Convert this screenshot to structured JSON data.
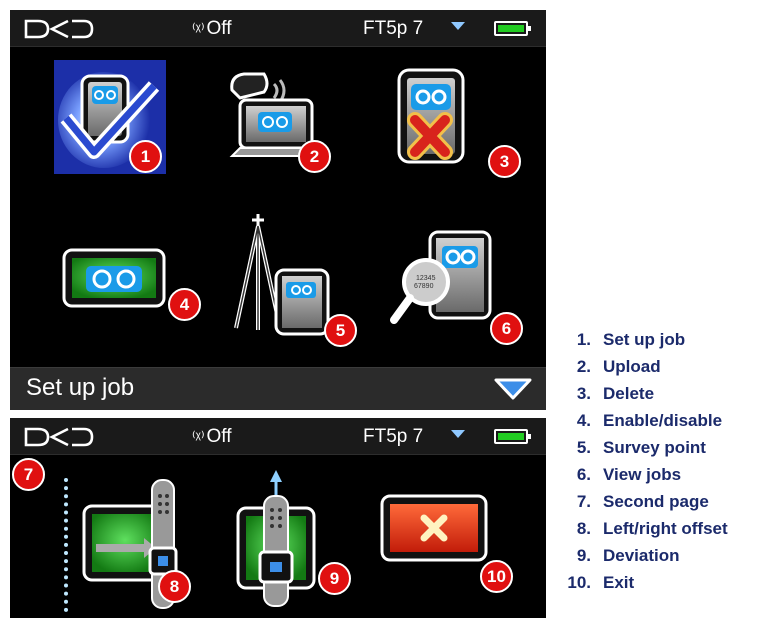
{
  "screen1": {
    "status": {
      "radio_label": "Off",
      "model": "FT5p 7",
      "battery_level": 1.0
    },
    "tiles": [
      {
        "num": "1",
        "icon": "set-up-job-icon"
      },
      {
        "num": "2",
        "icon": "upload-icon"
      },
      {
        "num": "3",
        "icon": "delete-job-icon"
      },
      {
        "num": "4",
        "icon": "enable-disable-icon"
      },
      {
        "num": "5",
        "icon": "survey-point-icon"
      },
      {
        "num": "6",
        "icon": "view-jobs-icon"
      }
    ],
    "page_title": "Set up job"
  },
  "screen2": {
    "status": {
      "radio_label": "Off",
      "model": "FT5p 7",
      "battery_level": 1.0
    },
    "page_badge": "7",
    "tiles": [
      {
        "num": "8",
        "icon": "left-right-offset-icon"
      },
      {
        "num": "9",
        "icon": "deviation-icon"
      },
      {
        "num": "10",
        "icon": "exit-icon"
      }
    ]
  },
  "legend": [
    {
      "num": "1.",
      "label": "Set up job"
    },
    {
      "num": "2.",
      "label": "Upload"
    },
    {
      "num": "3.",
      "label": "Delete"
    },
    {
      "num": "4.",
      "label": "Enable/disable"
    },
    {
      "num": "5.",
      "label": "Survey point"
    },
    {
      "num": "6.",
      "label": "View jobs"
    },
    {
      "num": "7.",
      "label": "Second page"
    },
    {
      "num": "8.",
      "label": "Left/right offset"
    },
    {
      "num": "9.",
      "label": "Deviation"
    },
    {
      "num": "10.",
      "label": "Exit"
    }
  ],
  "colors": {
    "selection": "#1c2fa8",
    "badge": "#e01010",
    "green": "#2aa52a",
    "exit_red": "#e23a16"
  }
}
